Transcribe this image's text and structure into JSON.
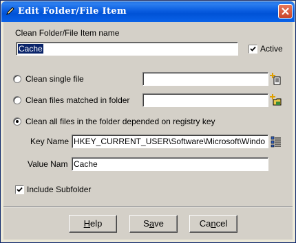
{
  "window": {
    "title": "Edit Folder/File Item"
  },
  "form": {
    "name_label": "Clean Folder/File Item name",
    "name_value": "Cache",
    "active_label": "Active",
    "active_checked": true,
    "options": {
      "single_file": "Clean single file",
      "files_matched": "Clean files matched  in folder",
      "registry": "Clean all files in the folder depended on registry key"
    },
    "selected_option": "registry",
    "single_file_value": "",
    "files_matched_value": "",
    "key_name_label": "Key Name",
    "key_name_value": "HKEY_CURRENT_USER\\Software\\Microsoft\\Windo",
    "value_name_label": "Value Nam",
    "value_name_value": "Cache",
    "include_subfolder_label": "Include Subfolder",
    "include_subfolder_checked": true
  },
  "buttons": {
    "help": {
      "label": "Help",
      "mnemonic": "H",
      "rest": "elp"
    },
    "save": {
      "label": "Save",
      "mnemonic": "a",
      "pre": "S",
      "rest": "ve"
    },
    "cancel": {
      "label": "Cancel",
      "mnemonic": "n",
      "pre": "Ca",
      "rest": "cel"
    }
  },
  "icons": {
    "title": "pencil-icon",
    "close": "close-icon",
    "browse_file": "add-file-icon",
    "browse_folder": "add-folder-icon",
    "registry": "registry-icon"
  },
  "colors": {
    "titlebar": "#0a5de0",
    "face": "#d4d0c8",
    "selection": "#0a246a"
  }
}
